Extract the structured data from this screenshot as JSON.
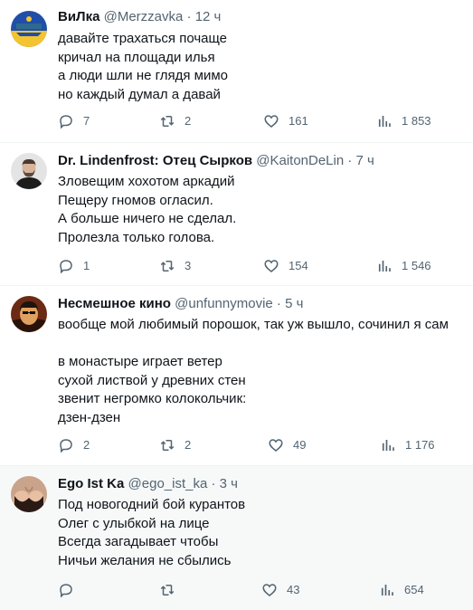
{
  "tweets": [
    {
      "name": "ВиЛка",
      "handle": "@Merzzavka",
      "time": "12 ч",
      "lines": [
        "давайте трахаться почаще",
        "кричал на площади илья",
        "а люди шли не глядя мимо",
        "но каждый думал а давай"
      ],
      "replies": "7",
      "retweets": "2",
      "likes": "161",
      "views": "1 853"
    },
    {
      "name": "Dr. Lindenfrost: Отец Сырков",
      "handle": "@KaitonDeLin",
      "time": "7 ч",
      "lines": [
        "Зловещим хохотом аркадий",
        "Пещеру гномов огласил.",
        "А больше ничего не сделал.",
        "Пролезла только голова."
      ],
      "replies": "1",
      "retweets": "3",
      "likes": "154",
      "views": "1 546"
    },
    {
      "name": "Несмешное кино",
      "handle": "@unfunnymovie",
      "time": "5 ч",
      "lines": [
        "вообще мой любимый порошок, так уж вышло, сочинил я сам",
        "",
        "в монастыре играет ветер",
        "сухой листвой у древних стен",
        "звенит негромко колокольчик:",
        "дзен-дзен"
      ],
      "replies": "2",
      "retweets": "2",
      "likes": "49",
      "views": "1 176"
    },
    {
      "name": "Ego Ist Ka",
      "handle": "@ego_ist_ka",
      "time": "3 ч",
      "lines": [
        "Под новогодний бой курантов",
        "Олег с улыбкой на лице",
        "Всегда загадывает чтобы",
        "Ничьи желания не сбылись"
      ],
      "replies": "",
      "retweets": "",
      "likes": "43",
      "views": "654"
    }
  ],
  "colors": {
    "text": "#0f1419",
    "secondary": "#536471",
    "divider": "#eff3f4",
    "highlight": "#f7f9f9"
  },
  "icons": {
    "reply": "reply-icon",
    "retweet": "retweet-icon",
    "like": "like-icon",
    "views": "views-icon"
  }
}
